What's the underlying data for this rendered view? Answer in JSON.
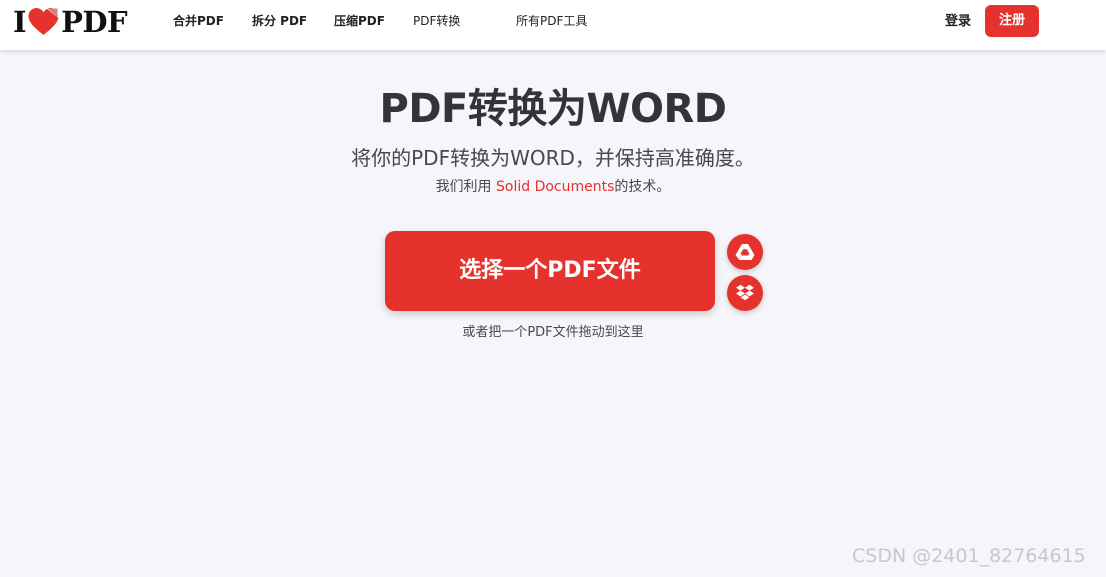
{
  "header": {
    "logo": {
      "left_text": "I",
      "right_text": "PDF",
      "heart_color": "#e5322d"
    },
    "nav": [
      {
        "label": "合并PDF"
      },
      {
        "label": "拆分 PDF"
      },
      {
        "label": "压缩PDF"
      },
      {
        "label": "PDF转换"
      },
      {
        "label": "所有PDF工具"
      }
    ],
    "login_label": "登录",
    "signup_label": "注册"
  },
  "main": {
    "title": "PDF转换为WORD",
    "subtitle": "将你的PDF转换为WORD，并保持高准确度。",
    "tech_prefix": "我们利用 ",
    "tech_link": "Solid Documents",
    "tech_suffix": "的技术。",
    "select_button_label": "选择一个PDF文件",
    "cloud_buttons": [
      {
        "icon": "google-drive-icon"
      },
      {
        "icon": "dropbox-icon"
      }
    ],
    "drop_hint": "或者把一个PDF文件拖动到这里"
  },
  "watermark": "CSDN @2401_82764615",
  "colors": {
    "accent": "#e5322d",
    "background": "#f5f5fa",
    "header_bg": "#ffffff",
    "text": "#33333b"
  }
}
